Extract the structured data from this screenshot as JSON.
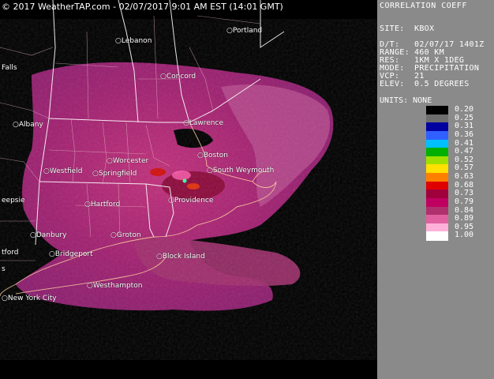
{
  "header": {
    "copyright": "© 2017 WeatherTAP.com - 02/07/2017  9:01 AM EST (14:01 GMT)"
  },
  "cities": [
    {
      "name": "Lebanon"
    },
    {
      "name": "Portland"
    },
    {
      "name": "Falls"
    },
    {
      "name": "Concord"
    },
    {
      "name": "Albany"
    },
    {
      "name": "Lawrence"
    },
    {
      "name": "Boston"
    },
    {
      "name": "Worcester"
    },
    {
      "name": "Westfield"
    },
    {
      "name": "Springfield"
    },
    {
      "name": "South Weymouth"
    },
    {
      "name": "eepsie"
    },
    {
      "name": "Hartford"
    },
    {
      "name": "Providence"
    },
    {
      "name": "Danbury"
    },
    {
      "name": "Groton"
    },
    {
      "name": "tford"
    },
    {
      "name": "Bridgeport"
    },
    {
      "name": "Block Island"
    },
    {
      "name": "s"
    },
    {
      "name": "Westhampton"
    },
    {
      "name": "New York City"
    }
  ],
  "panel": {
    "title": "CORRELATION COEFF",
    "site_label": "SITE:",
    "site": "KBOX",
    "date_label": "D/T:",
    "date": "02/07/17 1401Z",
    "range_label": "RANGE:",
    "range": "460 KM",
    "res_label": "RES:",
    "res": "1KM X 1DEG",
    "mode_label": "MODE:",
    "mode": "PRECIPITATION",
    "vcp_label": "VCP:",
    "vcp": "21",
    "elev_label": "ELEV:",
    "elev": "0.5 DEGREES",
    "units": "UNITS: NONE"
  },
  "legend": {
    "ticks": [
      "0.20",
      "0.25",
      "0.31",
      "0.36",
      "0.41",
      "0.47",
      "0.52",
      "0.57",
      "0.63",
      "0.68",
      "0.73",
      "0.79",
      "0.84",
      "0.89",
      "0.95",
      "1.00"
    ],
    "colors": [
      "#000000",
      "#6e6e6e",
      "#0000a0",
      "#3060ff",
      "#00c0ff",
      "#00b000",
      "#a0e000",
      "#ffe000",
      "#ff8000",
      "#e00000",
      "#a0003c",
      "#c00060",
      "#b0306e",
      "#e060a0",
      "#ffb0d8",
      "#ffffff"
    ]
  }
}
